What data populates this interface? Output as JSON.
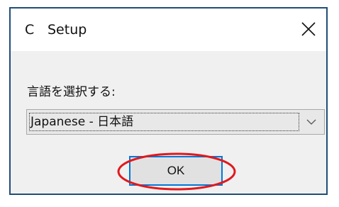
{
  "window": {
    "title": "Setup",
    "icon": "C",
    "close_icon": "close-icon"
  },
  "language": {
    "label": "言語を選択する:",
    "selected": "Japanese - 日本語",
    "arrow_icon": "chevron-down-icon"
  },
  "actions": {
    "ok_label": "OK"
  },
  "colors": {
    "border": "#1f4e79",
    "accent": "#0078d7",
    "highlight": "#e0191e"
  }
}
